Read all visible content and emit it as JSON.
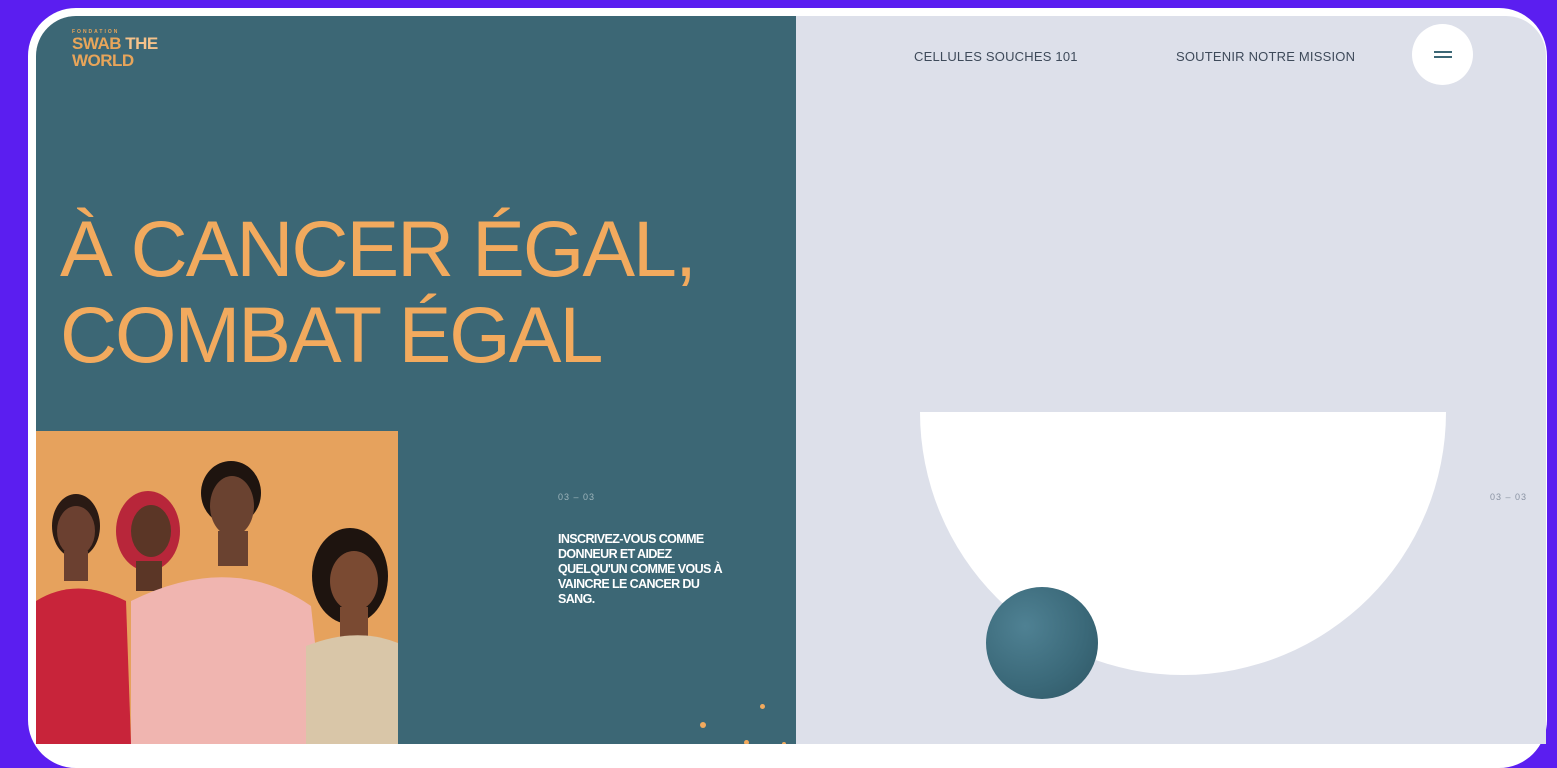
{
  "brand": {
    "small": "FONDATION",
    "line1_a": "SWAB ",
    "line1_b": "THE",
    "line2": "WORLD"
  },
  "hero": {
    "line1": "À CANCER ÉGAL,",
    "line2": "COMBAT ÉGAL"
  },
  "nav": {
    "item1": "CELLULES SOUCHES 101",
    "item2": "SOUTENIR NOTRE MISSION"
  },
  "menu": {
    "icon": "hamburger-icon"
  },
  "slide": {
    "counter_left": "03 – 03",
    "counter_right": "03 – 03",
    "text": "INSCRIVEZ-VOUS COMME DONNEUR ET AIDEZ QUELQU'UN COMME VOUS À VAINCRE LE CANCER DU SANG."
  },
  "colors": {
    "frame": "#5b1ef0",
    "teal": "#3c6775",
    "accent_orange": "#f2aa5e",
    "light_bg": "#dde0ea"
  }
}
